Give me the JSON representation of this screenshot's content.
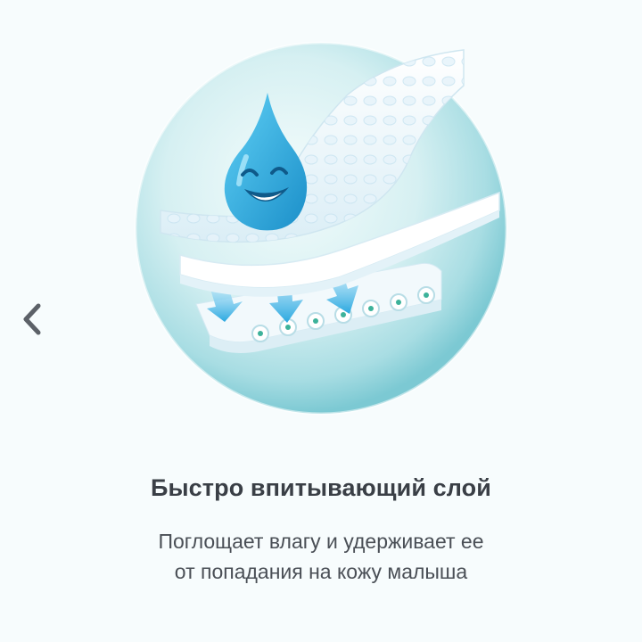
{
  "slide": {
    "title": "Быстро впитывающий слой",
    "description_lines": [
      "Поглощает влагу и удерживает ее",
      "от попадания на кожу малыша"
    ]
  },
  "navigation": {
    "prev_icon": "chevron-left-icon"
  },
  "colors": {
    "background": "#f7fcfd",
    "circle_light": "#e4f6f8",
    "circle_dark": "#7cc9d3",
    "droplet": "#2fa7dc",
    "arrow": "#3cb4e4",
    "text_title": "#3a3f46",
    "text_body": "#4a4f56",
    "chevron": "#5c6168"
  }
}
